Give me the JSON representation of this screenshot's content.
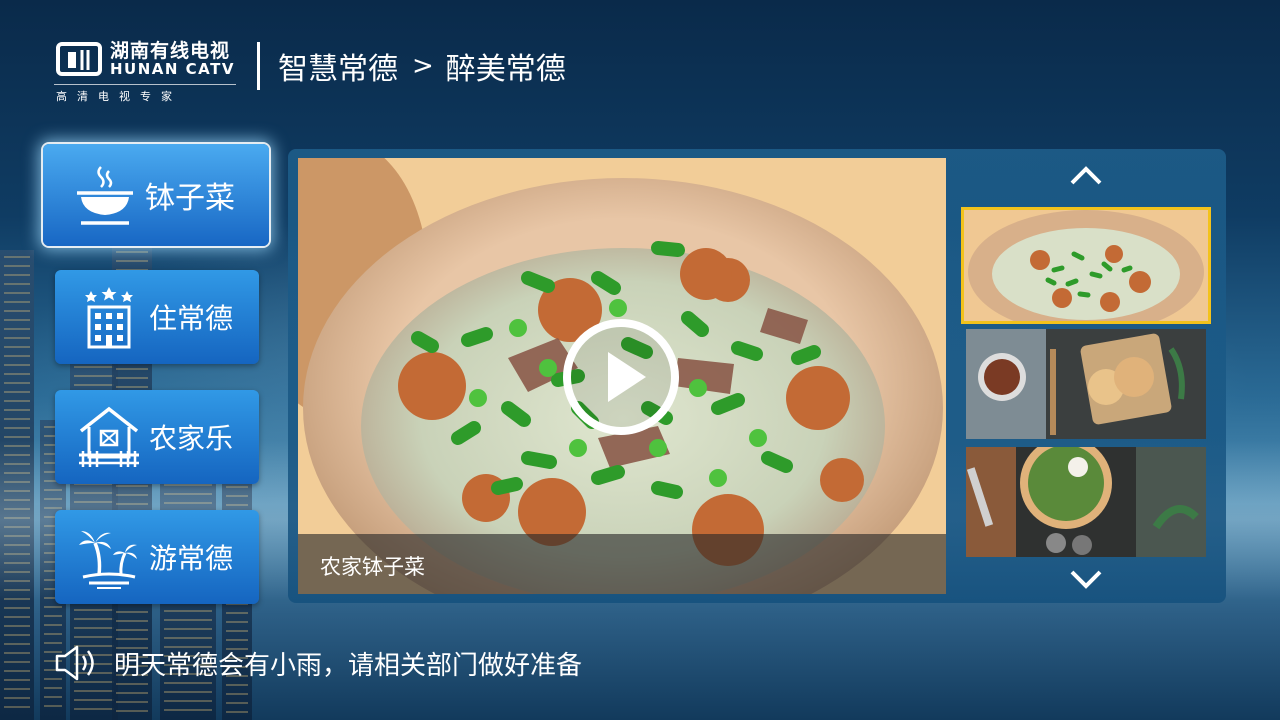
{
  "header": {
    "logo": {
      "name_cn": "湖南有线电视",
      "name_en": "HUNAN CATV",
      "tagline": "高清电视专家"
    },
    "breadcrumb": {
      "parent": "智慧常德",
      "separator": ">",
      "current": "醉美常德"
    }
  },
  "sidebar": {
    "items": [
      {
        "label": "钵子菜",
        "icon": "bowl-icon",
        "active": true
      },
      {
        "label": "住常德",
        "icon": "hotel-icon",
        "active": false
      },
      {
        "label": "农家乐",
        "icon": "farmhouse-icon",
        "active": false
      },
      {
        "label": "游常德",
        "icon": "palm-tree-icon",
        "active": false
      }
    ]
  },
  "player": {
    "caption": "农家钵子菜",
    "icon": "play-icon"
  },
  "thumbnails": {
    "items": [
      {
        "subject": "food-pot",
        "selected": true
      },
      {
        "subject": "soup-and-pie",
        "selected": false
      },
      {
        "subject": "pizza",
        "selected": false
      }
    ],
    "up_icon": "chevron-up-icon",
    "down_icon": "chevron-down-icon",
    "selected_border_color": "#f3c21b"
  },
  "notice": {
    "icon": "speaker-icon",
    "text": "明天常德会有小雨，请相关部门做好准备"
  },
  "colors": {
    "tile_blue": "#1565c0",
    "tile_blue_light": "#3199e6",
    "panel": "#1e5f8c"
  }
}
